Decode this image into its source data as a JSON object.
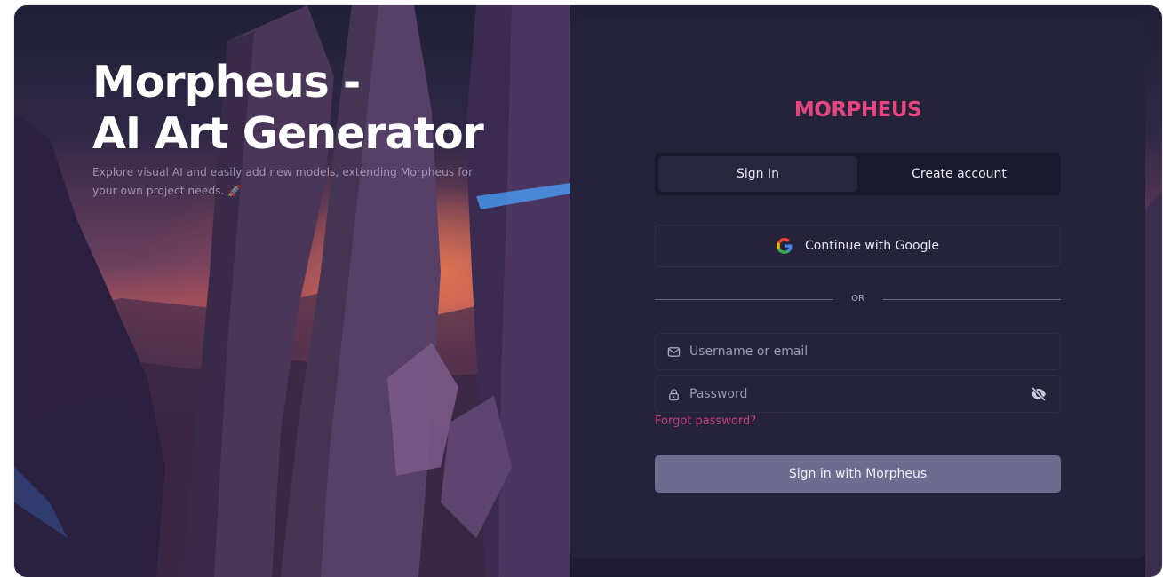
{
  "hero": {
    "title_line1": "Morpheus -",
    "title_line2": "AI Art Generator",
    "description": "Explore visual AI and easily add new models, extending Morpheus for your own project needs. 🚀"
  },
  "auth": {
    "brand": "MORPHEUS",
    "tabs": [
      {
        "label": "Sign In",
        "active": true
      },
      {
        "label": "Create account",
        "active": false
      }
    ],
    "google_label": "Continue with Google",
    "divider_text": "OR",
    "username_placeholder": "Username or email",
    "password_placeholder": "Password",
    "forgot_label": "Forgot password?",
    "submit_label": "Sign in with Morpheus"
  },
  "icons": {
    "google": "google-icon",
    "mail": "mail-icon",
    "lock": "lock-icon",
    "eye_off": "eye-off-icon"
  },
  "colors": {
    "brand": "#e6467f",
    "panel": "#24233a",
    "tab_bg": "#1a192d",
    "submit": "#6e6c8e",
    "link": "#c2407d"
  }
}
